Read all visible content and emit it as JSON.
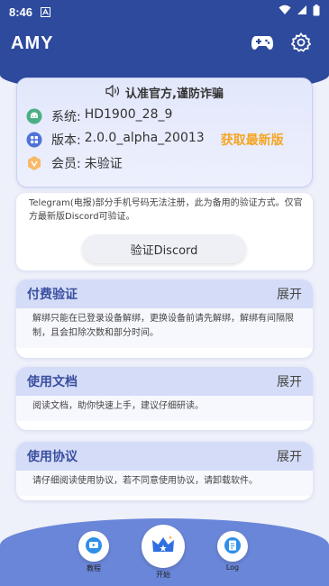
{
  "status_bar": {
    "time": "8:46"
  },
  "header": {
    "title": "AMY"
  },
  "info_card": {
    "notice": "认准官方,谨防诈骗",
    "system_label": "系统:",
    "system_value": "HD1900_28_9",
    "version_label": "版本:",
    "version_value": "2.0.0_alpha_20013",
    "update_link": "获取最新版",
    "member_label": "会员:",
    "member_value": "未验证"
  },
  "discord": {
    "description": "Telegram(电报)部分手机号码无法注册，此为备用的验证方式。仅官方最新版Discord可验证。",
    "button_label": "验证Discord"
  },
  "sections": [
    {
      "title": "付费验证",
      "expand": "展开",
      "body": "解绑只能在已登录设备解绑，更换设备前请先解绑，解绑有间隔限制，且会扣除次数和部分时间。"
    },
    {
      "title": "使用文档",
      "expand": "展开",
      "body": "阅读文档，助你快速上手，建议仔细研读。"
    },
    {
      "title": "使用协议",
      "expand": "展开",
      "body": "请仔细阅读使用协议，若不同意使用协议，请卸载软件。"
    }
  ],
  "bottom_nav": {
    "tutorial": "教程",
    "start": "开始",
    "log": "Log"
  },
  "colors": {
    "primary": "#2d4a9c",
    "accent": "#f5a623",
    "nav_bg": "#6a86d8",
    "section_head": "#d5dcf7"
  }
}
